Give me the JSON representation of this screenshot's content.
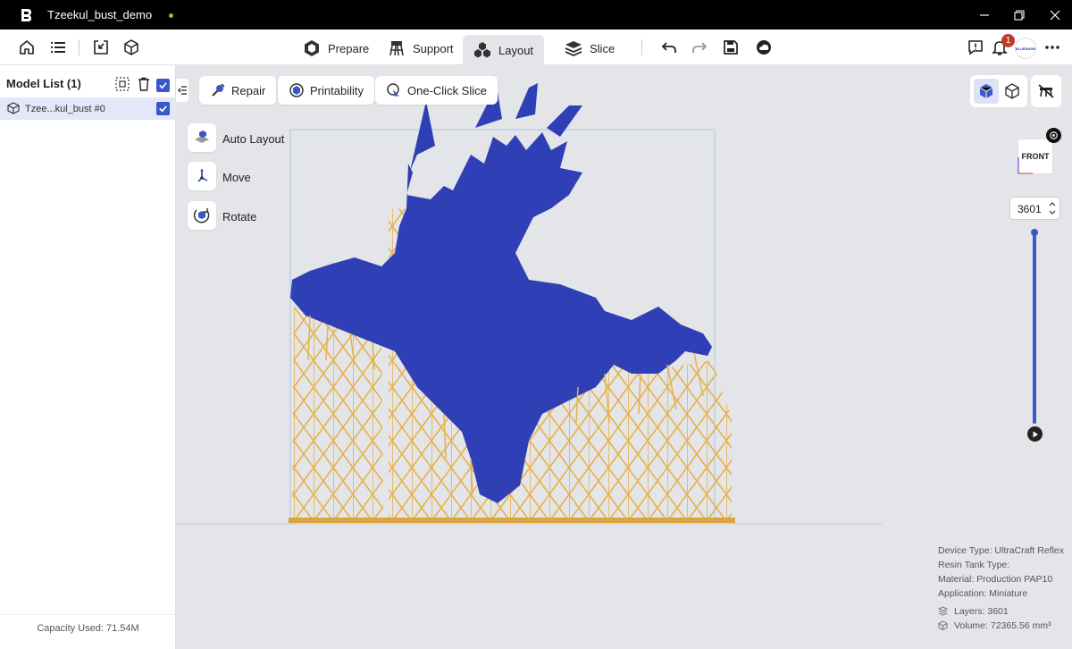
{
  "window": {
    "title": "Tzeekul_bust_demo"
  },
  "tabs": [
    {
      "label": "Prepare",
      "active": false
    },
    {
      "label": "Support",
      "active": false
    },
    {
      "label": "Layout",
      "active": true
    },
    {
      "label": "Slice",
      "active": false
    }
  ],
  "notifications": {
    "count": "1"
  },
  "avatar": {
    "text": "BLUEBARN"
  },
  "model_list": {
    "title": "Model List (1)",
    "items": [
      {
        "name": "Tzee...kul_bust #0",
        "checked": true
      }
    ],
    "capacity": "Capacity Used: 71.54M"
  },
  "actions": {
    "repair": "Repair",
    "printability": "Printability",
    "one_click_slice": "One-Click Slice"
  },
  "side_tools": {
    "auto_layout": "Auto Layout",
    "move": "Move",
    "rotate": "Rotate"
  },
  "orientation": {
    "label": "FRONT"
  },
  "layer_slider": {
    "value": "3601",
    "fraction": 1.0
  },
  "info": {
    "device_type": "Device Type:  UltraCraft Reflex",
    "resin_tank": "Resin Tank Type:",
    "material": "Material:  Production PAP10",
    "application": "Application:  Miniature",
    "layers": "Layers: 3601",
    "volume": "Volume: 72365.56 mm³"
  },
  "colors": {
    "accent": "#3a57c9",
    "model": "#2f3fb5",
    "support": "#e7b44a"
  }
}
